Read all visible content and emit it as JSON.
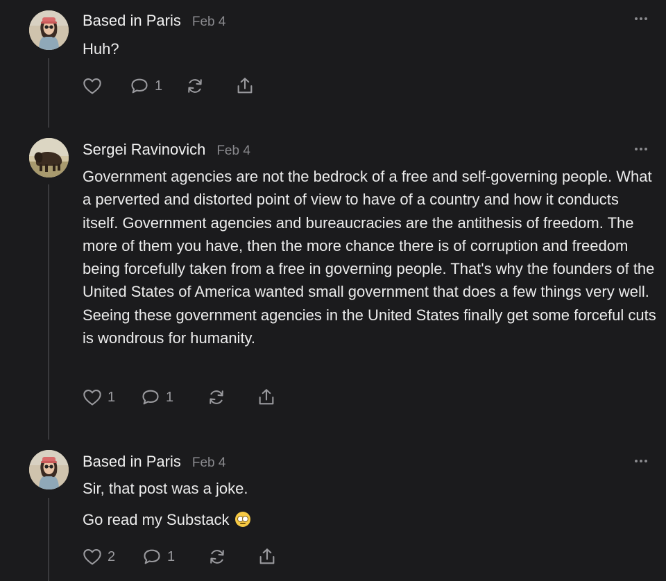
{
  "posts": [
    {
      "author": "Based in Paris",
      "date": "Feb 4",
      "paragraphs": [
        "Huh?"
      ],
      "likes": "",
      "replies": "1"
    },
    {
      "author": "Sergei Ravinovich",
      "date": "Feb 4",
      "paragraphs": [
        "Government agencies are not the bedrock of a free and self-governing people. What a perverted and distorted point of view to have of a country and how it conducts itself. Government agencies and bureaucracies are the antithesis of freedom. The more of them you have, then the more chance there is of corruption and freedom being forcefully taken from a free in governing people. That's why the founders of the United States of America wanted small government that does a few things very well. Seeing these government agencies in the United States finally get some forceful cuts is wondrous for humanity."
      ],
      "likes": "1",
      "replies": "1"
    },
    {
      "author": "Based in Paris",
      "date": "Feb 4",
      "paragraphs": [
        "Sir, that post was a joke.",
        "Go read my Substack"
      ],
      "emoji": "face-with-rolling-eyes",
      "likes": "2",
      "replies": "1"
    }
  ],
  "colors": {
    "background": "#1b1b1d",
    "text": "#ececec",
    "muted": "#8a8a8e",
    "thread_line": "#3a3a3d"
  }
}
